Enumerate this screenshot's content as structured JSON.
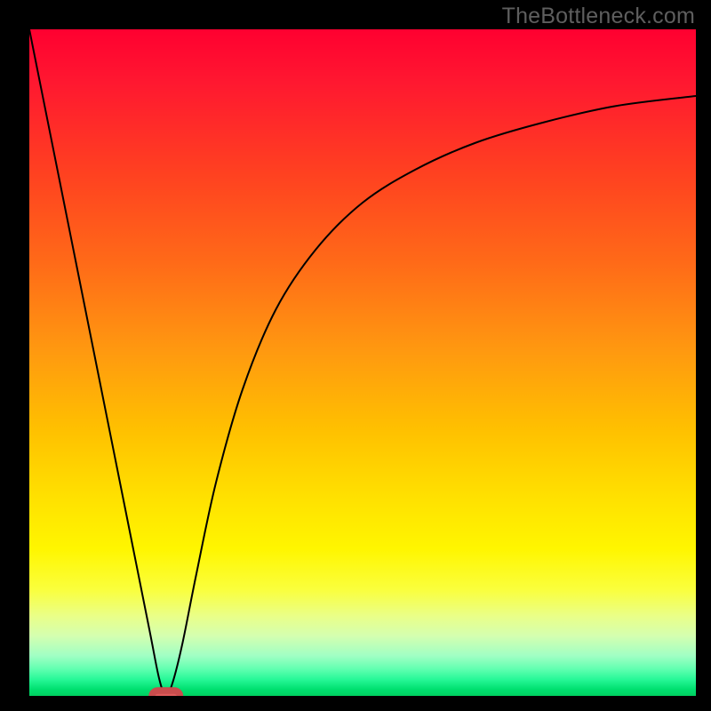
{
  "watermark": "TheBottleneck.com",
  "chart_data": {
    "type": "line",
    "title": "",
    "xlabel": "",
    "ylabel": "",
    "xlim": [
      0,
      100
    ],
    "ylim": [
      0,
      100
    ],
    "grid": false,
    "series": [
      {
        "name": "bottleneck-curve",
        "x": [
          0,
          5,
          10,
          15,
          18,
          19.5,
          20.5,
          21.5,
          23,
          25,
          28,
          32,
          37,
          43,
          50,
          58,
          67,
          77,
          88,
          100
        ],
        "values": [
          100,
          75,
          50,
          25,
          10,
          2.5,
          0,
          2,
          8,
          18,
          32,
          46,
          58,
          67,
          74,
          79,
          83,
          86,
          88.5,
          90
        ]
      }
    ],
    "marker": {
      "x": 20.5,
      "y": 0,
      "width_pct": 4.2,
      "height_pct": 1.6
    },
    "background_gradient": {
      "stops": [
        {
          "pct": 0,
          "color": "#ff0030"
        },
        {
          "pct": 50,
          "color": "#ffb000"
        },
        {
          "pct": 80,
          "color": "#fff600"
        },
        {
          "pct": 100,
          "color": "#00d060"
        }
      ]
    }
  }
}
